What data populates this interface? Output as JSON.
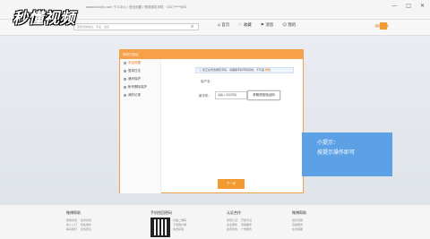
{
  "browser": {
    "url": "www.kuaiJin.com   个人中心 / 安全设置 / 修改绑定手机 · 1527****830",
    "controls": [
      "—",
      "□",
      "✕"
    ]
  },
  "watermark": {
    "text": "秒懂视频"
  },
  "search": {
    "placeholder": "搜索当前地址、专业、会员"
  },
  "top_nav": {
    "items": [
      "⌂ 首页",
      "♡ 收藏",
      "⚑ 消息",
      "☺ 我的"
    ]
  },
  "modal": {
    "title": "修改已验证",
    "sidebar": [
      {
        "label": "安全设置",
        "active": true
      },
      {
        "label": "登录日志",
        "active": false
      },
      {
        "label": "通讯保护",
        "active": false
      },
      {
        "label": "帐号删除保护",
        "active": false
      },
      {
        "label": "我的记录",
        "active": false
      }
    ],
    "notice_text": "您正在修改绑定手机，请确保手机号码有效，不可逆",
    "notice_link": "帮助",
    "user_label": "用户名：",
    "phone_label": "新手机：",
    "phone_placeholder": "请输入手机号码",
    "code_button": "获取短信验证码",
    "next_button": "下一步"
  },
  "tip": {
    "title": "小提示：",
    "body": "按提示操作即可"
  },
  "footer": {
    "col1": {
      "title": "微博帮助",
      "links": [
        "使用条款",
        "技术支持",
        "新人入门",
        "隐私保护",
        "联系我们",
        "反馈意见"
      ]
    },
    "col2": {
      "title": "手机找回密码",
      "lines": [
        "扫描二维码",
        "下载客户端",
        "免费获取"
      ]
    },
    "col3": {
      "title": "认证合作",
      "links": [
        "商家认证",
        "开放平台",
        "企业服务",
        "营销服务",
        "政府机构",
        "广告服务"
      ]
    },
    "col4": {
      "title": "微博帮助",
      "links": [
        "常见问题",
        "自助服务",
        "在线客服"
      ]
    }
  }
}
